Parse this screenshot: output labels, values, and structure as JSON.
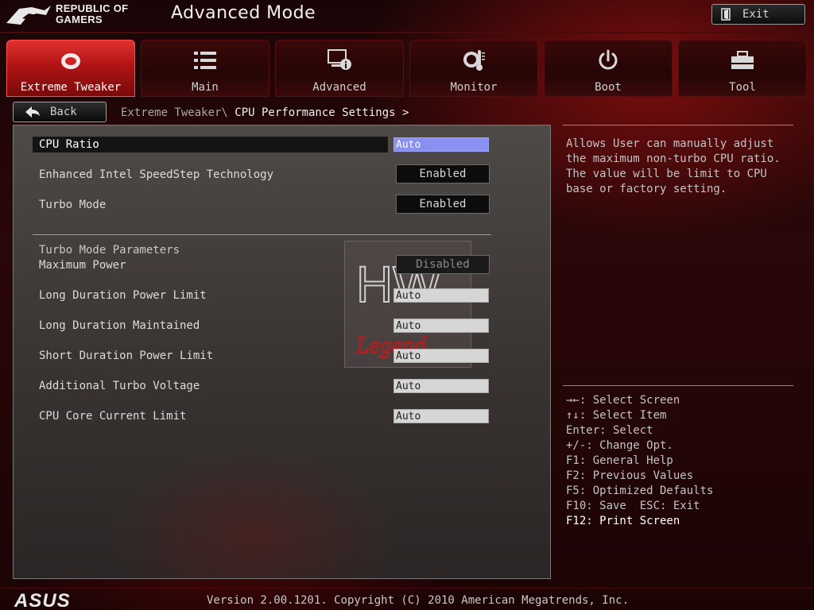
{
  "header": {
    "brand_line1": "REPUBLIC OF",
    "brand_line2": "GAMERS",
    "title": "Advanced Mode",
    "exit_label": "Exit"
  },
  "tabs": [
    {
      "label": "Extreme Tweaker",
      "icon": "tweaker-icon",
      "active": true
    },
    {
      "label": "Main",
      "icon": "list-icon",
      "active": false
    },
    {
      "label": "Advanced",
      "icon": "advanced-icon",
      "active": false
    },
    {
      "label": "Monitor",
      "icon": "thermometer-icon",
      "active": false
    },
    {
      "label": "Boot",
      "icon": "power-icon",
      "active": false
    },
    {
      "label": "Tool",
      "icon": "toolbox-icon",
      "active": false
    }
  ],
  "nav": {
    "back_label": "Back",
    "breadcrumb_parent": "Extreme Tweaker\\",
    "breadcrumb_current": " CPU Performance Settings >"
  },
  "settings": {
    "cpu_ratio": {
      "label": "CPU Ratio",
      "value": "Auto"
    },
    "speedstep": {
      "label": "Enhanced Intel SpeedStep Technology",
      "value": "Enabled"
    },
    "turbo_mode": {
      "label": "Turbo Mode",
      "value": "Enabled"
    },
    "section_title": "Turbo Mode Parameters",
    "max_power": {
      "label": "Maximum Power",
      "value": "Disabled"
    },
    "long_power": {
      "label": "Long Duration Power Limit",
      "value": "Auto"
    },
    "long_maintained": {
      "label": "Long Duration Maintained",
      "value": "Auto"
    },
    "short_power": {
      "label": "Short Duration Power Limit",
      "value": "Auto"
    },
    "turbo_voltage": {
      "label": "Additional Turbo Voltage",
      "value": "Auto"
    },
    "core_current": {
      "label": "CPU Core Current Limit",
      "value": "Auto"
    }
  },
  "help": {
    "text": "Allows User can manually adjust the maximum non-turbo CPU ratio. The value will be limit to CPU base or factory setting."
  },
  "keys": [
    "→←: Select Screen",
    "↑↓: Select Item",
    "Enter: Select",
    "+/-: Change Opt.",
    "F1: General Help",
    "F2: Previous Values",
    "F5: Optimized Defaults",
    "F10: Save  ESC: Exit",
    "F12: Print Screen"
  ],
  "footer": {
    "brand": "ASUS",
    "version": "Version 2.00.1201. Copyright (C) 2010 American Megatrends, Inc."
  },
  "colors": {
    "accent": "#d01c1c",
    "selected_value": "#8a90f0"
  }
}
